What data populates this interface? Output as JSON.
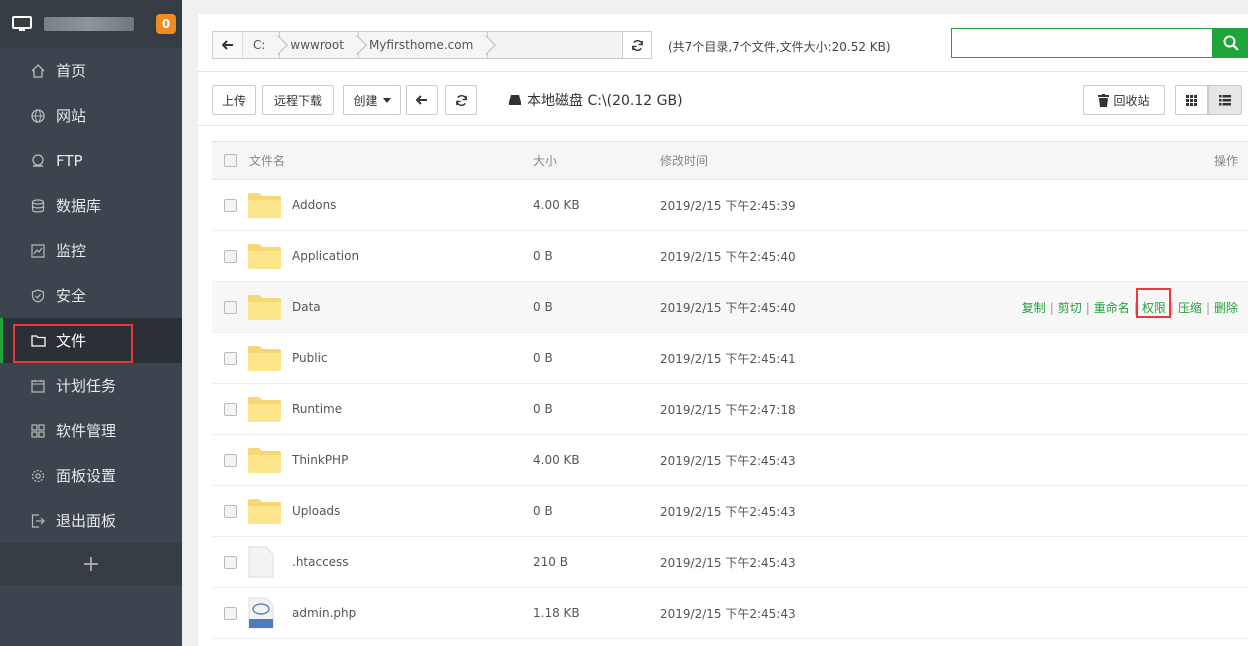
{
  "sidebar": {
    "badge": "0",
    "items": [
      {
        "label": "首页",
        "icon": "home-icon"
      },
      {
        "label": "网站",
        "icon": "globe-icon"
      },
      {
        "label": "FTP",
        "icon": "ftp-icon"
      },
      {
        "label": "数据库",
        "icon": "database-icon"
      },
      {
        "label": "监控",
        "icon": "monitor-chart-icon"
      },
      {
        "label": "安全",
        "icon": "shield-icon"
      },
      {
        "label": "文件",
        "icon": "folder-icon"
      },
      {
        "label": "计划任务",
        "icon": "calendar-icon"
      },
      {
        "label": "软件管理",
        "icon": "grid-icon"
      },
      {
        "label": "面板设置",
        "icon": "gear-icon"
      },
      {
        "label": "退出面板",
        "icon": "logout-icon"
      }
    ],
    "add": "+"
  },
  "path": {
    "crumbs": [
      "C:",
      "wwwroot",
      "Myfirsthome.com"
    ],
    "summary": "(共7个目录,7个文件,文件大小:20.52 KB)"
  },
  "toolbar": {
    "upload": "上传",
    "remote_download": "远程下载",
    "create": "创建",
    "disk": "本地磁盘 C:\\(20.12 GB)",
    "recycle": "回收站"
  },
  "table": {
    "headers": {
      "name": "文件名",
      "size": "大小",
      "time": "修改时间",
      "op": "操作"
    },
    "rows": [
      {
        "name": "Addons",
        "size": "4.00 KB",
        "time": "2019/2/15 下午2:45:39",
        "type": "folder"
      },
      {
        "name": "Application",
        "size": "0 B",
        "time": "2019/2/15 下午2:45:40",
        "type": "folder"
      },
      {
        "name": "Data",
        "size": "0 B",
        "time": "2019/2/15 下午2:45:40",
        "type": "folder"
      },
      {
        "name": "Public",
        "size": "0 B",
        "time": "2019/2/15 下午2:45:41",
        "type": "folder"
      },
      {
        "name": "Runtime",
        "size": "0 B",
        "time": "2019/2/15 下午2:47:18",
        "type": "folder"
      },
      {
        "name": "ThinkPHP",
        "size": "4.00 KB",
        "time": "2019/2/15 下午2:45:43",
        "type": "folder"
      },
      {
        "name": "Uploads",
        "size": "0 B",
        "time": "2019/2/15 下午2:45:43",
        "type": "folder"
      },
      {
        "name": ".htaccess",
        "size": "210 B",
        "time": "2019/2/15 下午2:45:43",
        "type": "file"
      },
      {
        "name": "admin.php",
        "size": "1.18 KB",
        "time": "2019/2/15 下午2:45:43",
        "type": "php"
      }
    ],
    "ops": [
      "复制",
      "剪切",
      "重命名",
      "权限",
      "压缩",
      "删除"
    ]
  },
  "colors": {
    "accent": "#20a53a",
    "sidebar": "#3c444d",
    "highlight": "#e83a3a",
    "badge": "#f08a24"
  }
}
